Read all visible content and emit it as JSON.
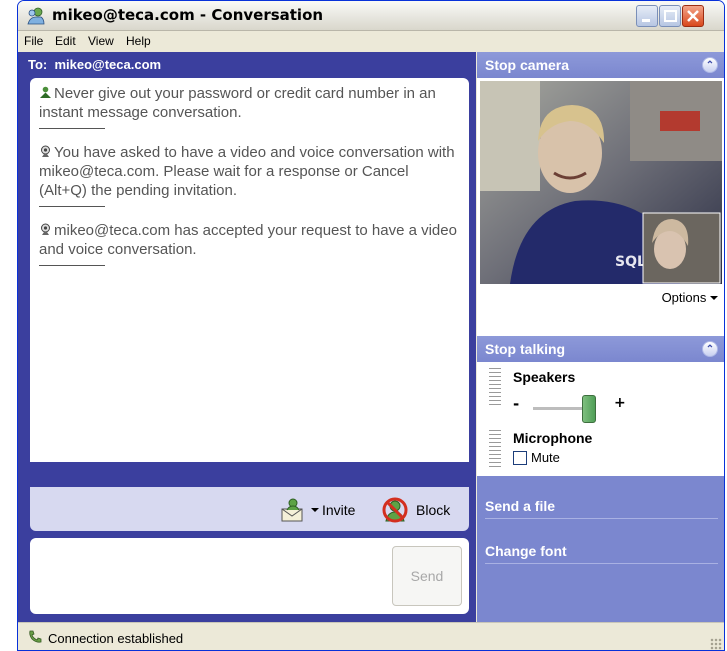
{
  "window": {
    "title": "mikeo@teca.com - Conversation",
    "icon": "messenger-buddy-icon"
  },
  "menu": [
    "File",
    "Edit",
    "View",
    "Help"
  ],
  "conversation": {
    "to_label": "To:",
    "to_address": "mikeo@teca.com",
    "messages": [
      {
        "icon": "safety-tip-icon",
        "text": "Never give out your password or credit card number in an instant message conversation."
      },
      {
        "icon": "webcam-icon",
        "text": "You have asked to have a video and voice conversation with mikeo@teca.com. Please wait for a response or Cancel (Alt+Q) the pending invitation."
      },
      {
        "icon": "webcam-icon",
        "text": "mikeo@teca.com has accepted your request to have a video and voice conversation."
      }
    ],
    "actions": {
      "invite_label": "Invite",
      "block_label": "Block"
    },
    "send_label": "Send"
  },
  "right_panel": {
    "camera": {
      "header": "Stop camera",
      "options_label": "Options"
    },
    "audio": {
      "header": "Stop talking",
      "speakers_label": "Speakers",
      "minus": "-",
      "plus": "+",
      "speaker_volume_fraction": 0.9,
      "microphone_label": "Microphone",
      "mute_label": "Mute",
      "mute_checked": false
    },
    "send_file_label": "Send a file",
    "change_font_label": "Change font"
  },
  "status": {
    "text": "Connection established"
  },
  "colors": {
    "left_background": "#3b3f9e",
    "right_background": "#7b87cf",
    "send_disabled": "#a8a8a8"
  }
}
